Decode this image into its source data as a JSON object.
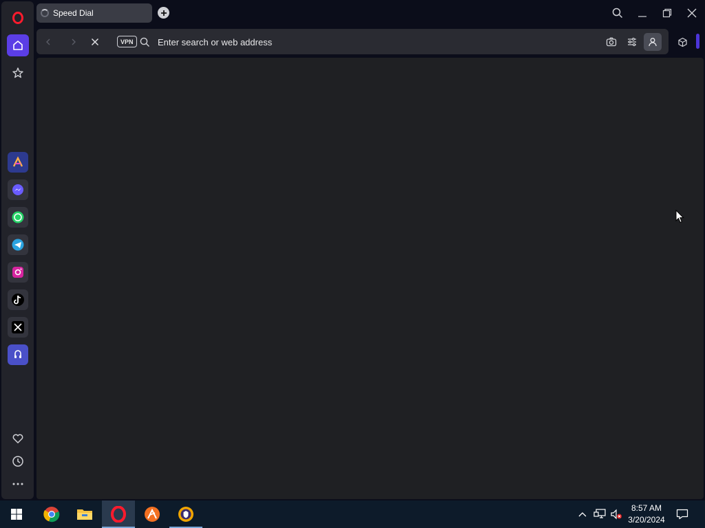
{
  "browser": {
    "tab": {
      "title": "Speed Dial"
    },
    "address_bar": {
      "placeholder": "Enter search or web address",
      "value": ""
    },
    "vpn_label": "VPN"
  },
  "sidebar": {
    "top": [
      "home-icon",
      "star-icon"
    ],
    "apps": [
      "aria-icon",
      "messenger-icon",
      "whatsapp-icon",
      "telegram-icon",
      "instagram-icon",
      "tiktok-icon",
      "x-icon",
      "music-player-icon"
    ],
    "bottom": [
      "heart-icon",
      "history-icon",
      "more-icon"
    ]
  },
  "taskbar": {
    "apps": [
      "windows-start-icon",
      "chrome-icon",
      "file-explorer-icon",
      "opera-icon",
      "app-icon",
      "vpn-app-icon"
    ],
    "clock": {
      "time": "8:57 AM",
      "date": "3/20/2024"
    }
  },
  "colors": {
    "accent": "#5b3ee6",
    "content_bg": "#1f2023",
    "taskbar_bg": "#0d1b2a"
  }
}
